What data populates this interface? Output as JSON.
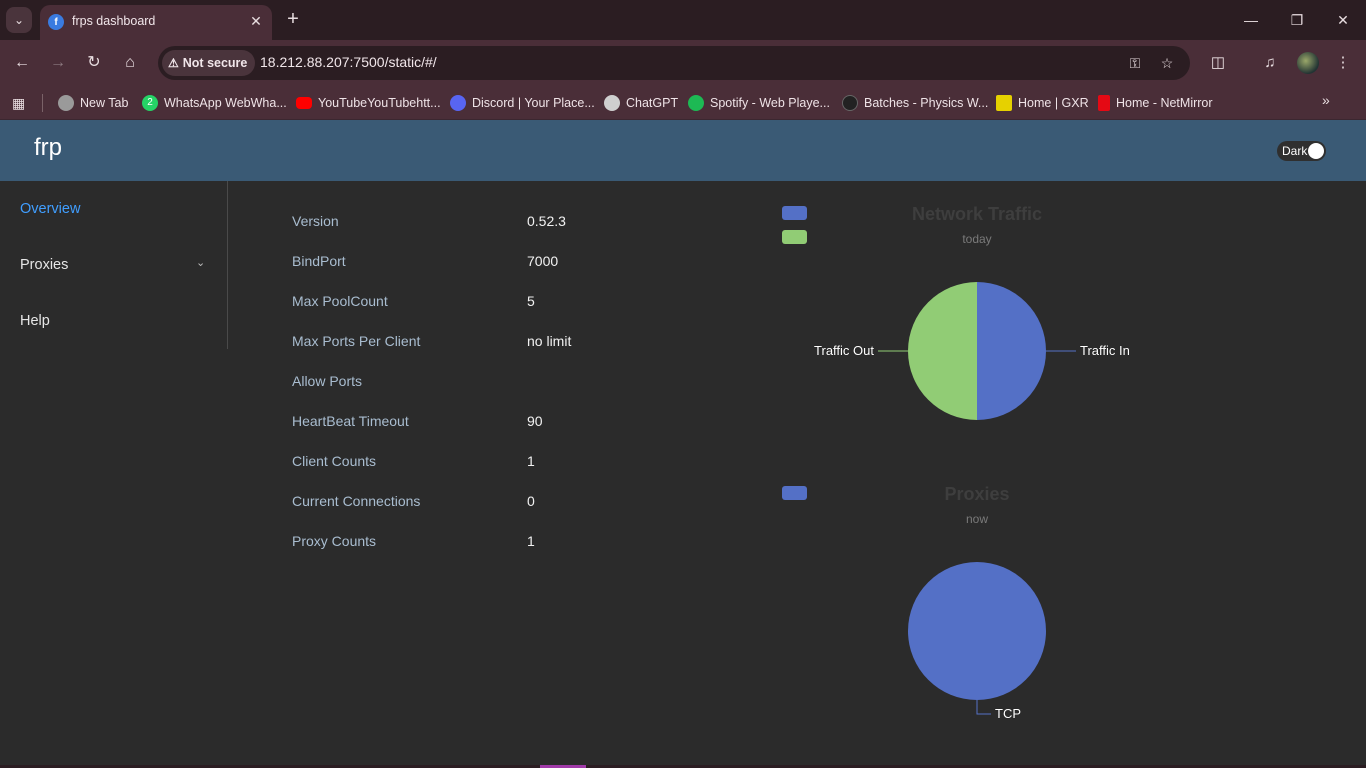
{
  "browser": {
    "tab_title": "frps dashboard",
    "tab_favicon_letter": "f",
    "security_label": "Not secure",
    "url": "18.212.88.207:7500/static/#/",
    "bookmarks": [
      {
        "label": "New Tab",
        "icon": "globe-icon",
        "color": "#9a9a9a"
      },
      {
        "label": "WhatsApp WebWha...",
        "icon": "whatsapp-icon",
        "color": "#25d366"
      },
      {
        "label": "YouTubeYouTubehtt...",
        "icon": "youtube-icon",
        "color": "#ff0000"
      },
      {
        "label": "Discord | Your Place...",
        "icon": "discord-icon",
        "color": "#5865f2"
      },
      {
        "label": "ChatGPT",
        "icon": "chatgpt-icon",
        "color": "#cfcfcf"
      },
      {
        "label": "Spotify - Web Playe...",
        "icon": "spotify-icon",
        "color": "#1db954"
      },
      {
        "label": "Batches - Physics W...",
        "icon": "batches-icon",
        "color": "#222222"
      },
      {
        "label": "Home | GXR",
        "icon": "gxr-icon",
        "color": "#e6d100"
      },
      {
        "label": "Home - NetMirror",
        "icon": "netmirror-icon",
        "color": "#e50914"
      }
    ],
    "whatsapp_badge": "2"
  },
  "app": {
    "brand": "frp",
    "theme_toggle_label": "Dark",
    "theme_dark": true
  },
  "sidebar": {
    "items": [
      {
        "label": "Overview",
        "active": true
      },
      {
        "label": "Proxies",
        "active": false,
        "expandable": true
      },
      {
        "label": "Help",
        "active": false
      }
    ]
  },
  "server_info": [
    {
      "label": "Version",
      "value": "0.52.3"
    },
    {
      "label": "BindPort",
      "value": "7000"
    },
    {
      "label": "Max PoolCount",
      "value": "5"
    },
    {
      "label": "Max Ports Per Client",
      "value": "no limit"
    },
    {
      "label": "Allow Ports",
      "value": ""
    },
    {
      "label": "HeartBeat Timeout",
      "value": "90"
    },
    {
      "label": "Client Counts",
      "value": "1"
    },
    {
      "label": "Current Connections",
      "value": "0"
    },
    {
      "label": "Proxy Counts",
      "value": "1"
    }
  ],
  "colors": {
    "traffic_in": "#5470c6",
    "traffic_out": "#91cc75",
    "tcp": "#5470c6",
    "active_link": "#409eff",
    "header_bg": "#3a5a75"
  },
  "chart_data": [
    {
      "type": "pie",
      "title": "Network Traffic",
      "subtitle": "today",
      "legend": "top-left",
      "slices": [
        {
          "name": "Traffic In",
          "value": 50
        },
        {
          "name": "Traffic Out",
          "value": 50
        }
      ]
    },
    {
      "type": "pie",
      "title": "Proxies",
      "subtitle": "now",
      "legend": "top-left",
      "slices": [
        {
          "name": "TCP",
          "value": 1
        }
      ]
    }
  ]
}
